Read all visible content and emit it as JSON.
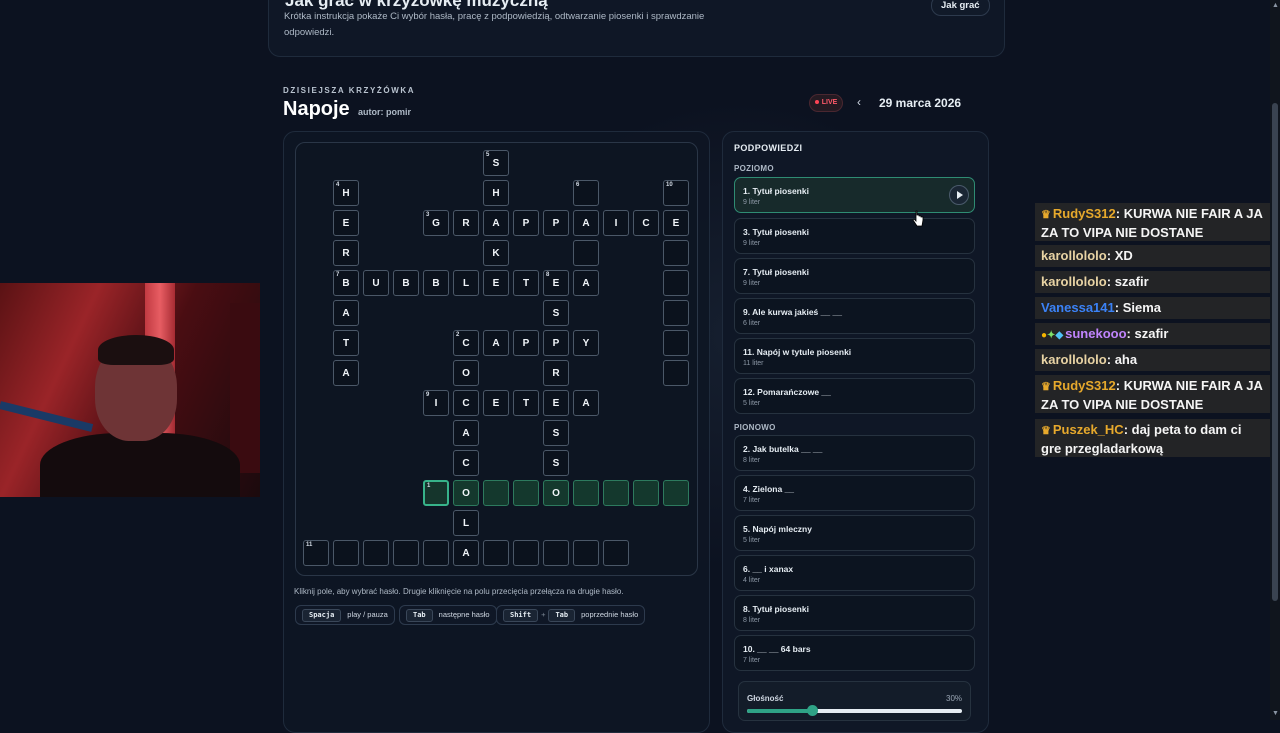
{
  "intro": {
    "title_cut": "Jak grać w krzyżówkę muzyczną",
    "description": "Krótka instrukcja pokaże Ci wybór hasła, pracę z podpowiedzią, odtwarzanie piosenki i sprawdzanie odpowiedzi.",
    "button": "Jak grać"
  },
  "header": {
    "overline": "DZISIEJSZA KRZYŻÓWKA",
    "title": "Napoje",
    "author": "autor: pomir",
    "live": "LIVE",
    "prev_icon": "‹",
    "date": "29 marca 2026"
  },
  "grid": {
    "cells": [
      {
        "c": 6,
        "r": 0,
        "n": "5",
        "l": "S"
      },
      {
        "c": 1,
        "r": 1,
        "n": "4",
        "l": "H"
      },
      {
        "c": 6,
        "r": 1,
        "n": "",
        "l": "H"
      },
      {
        "c": 9,
        "r": 1,
        "n": "6",
        "l": ""
      },
      {
        "c": 12,
        "r": 1,
        "n": "10",
        "l": ""
      },
      {
        "c": 1,
        "r": 2,
        "n": "",
        "l": "E"
      },
      {
        "c": 4,
        "r": 2,
        "n": "3",
        "l": "G"
      },
      {
        "c": 5,
        "r": 2,
        "n": "",
        "l": "R"
      },
      {
        "c": 6,
        "r": 2,
        "n": "",
        "l": "A"
      },
      {
        "c": 7,
        "r": 2,
        "n": "",
        "l": "P"
      },
      {
        "c": 8,
        "r": 2,
        "n": "",
        "l": "P"
      },
      {
        "c": 9,
        "r": 2,
        "n": "",
        "l": "A"
      },
      {
        "c": 10,
        "r": 2,
        "n": "",
        "l": "I"
      },
      {
        "c": 11,
        "r": 2,
        "n": "",
        "l": "C"
      },
      {
        "c": 12,
        "r": 2,
        "n": "",
        "l": "E"
      },
      {
        "c": 1,
        "r": 3,
        "n": "",
        "l": "R"
      },
      {
        "c": 6,
        "r": 3,
        "n": "",
        "l": "K"
      },
      {
        "c": 9,
        "r": 3,
        "n": "",
        "l": ""
      },
      {
        "c": 12,
        "r": 3,
        "n": "",
        "l": ""
      },
      {
        "c": 1,
        "r": 4,
        "n": "7",
        "l": "B"
      },
      {
        "c": 2,
        "r": 4,
        "n": "",
        "l": "U"
      },
      {
        "c": 3,
        "r": 4,
        "n": "",
        "l": "B"
      },
      {
        "c": 4,
        "r": 4,
        "n": "",
        "l": "B"
      },
      {
        "c": 5,
        "r": 4,
        "n": "",
        "l": "L"
      },
      {
        "c": 6,
        "r": 4,
        "n": "",
        "l": "E"
      },
      {
        "c": 7,
        "r": 4,
        "n": "",
        "l": "T"
      },
      {
        "c": 8,
        "r": 4,
        "n": "8",
        "l": "E"
      },
      {
        "c": 9,
        "r": 4,
        "n": "",
        "l": "A"
      },
      {
        "c": 12,
        "r": 4,
        "n": "",
        "l": ""
      },
      {
        "c": 1,
        "r": 5,
        "n": "",
        "l": "A"
      },
      {
        "c": 8,
        "r": 5,
        "n": "",
        "l": "S"
      },
      {
        "c": 12,
        "r": 5,
        "n": "",
        "l": ""
      },
      {
        "c": 1,
        "r": 6,
        "n": "",
        "l": "T"
      },
      {
        "c": 5,
        "r": 6,
        "n": "2",
        "l": "C"
      },
      {
        "c": 6,
        "r": 6,
        "n": "",
        "l": "A"
      },
      {
        "c": 7,
        "r": 6,
        "n": "",
        "l": "P"
      },
      {
        "c": 8,
        "r": 6,
        "n": "",
        "l": "P"
      },
      {
        "c": 9,
        "r": 6,
        "n": "",
        "l": "Y"
      },
      {
        "c": 12,
        "r": 6,
        "n": "",
        "l": ""
      },
      {
        "c": 1,
        "r": 7,
        "n": "",
        "l": "A"
      },
      {
        "c": 5,
        "r": 7,
        "n": "",
        "l": "O"
      },
      {
        "c": 8,
        "r": 7,
        "n": "",
        "l": "R"
      },
      {
        "c": 12,
        "r": 7,
        "n": "",
        "l": ""
      },
      {
        "c": 4,
        "r": 8,
        "n": "9",
        "l": "I"
      },
      {
        "c": 5,
        "r": 8,
        "n": "",
        "l": "C"
      },
      {
        "c": 6,
        "r": 8,
        "n": "",
        "l": "E"
      },
      {
        "c": 7,
        "r": 8,
        "n": "",
        "l": "T"
      },
      {
        "c": 8,
        "r": 8,
        "n": "",
        "l": "E"
      },
      {
        "c": 9,
        "r": 8,
        "n": "",
        "l": "A"
      },
      {
        "c": 5,
        "r": 9,
        "n": "",
        "l": "A"
      },
      {
        "c": 8,
        "r": 9,
        "n": "",
        "l": "S"
      },
      {
        "c": 5,
        "r": 10,
        "n": "",
        "l": "C"
      },
      {
        "c": 8,
        "r": 10,
        "n": "",
        "l": "S"
      },
      {
        "c": 4,
        "r": 11,
        "n": "1",
        "l": "",
        "s": "active"
      },
      {
        "c": 5,
        "r": 11,
        "n": "",
        "l": "O",
        "s": "hl"
      },
      {
        "c": 6,
        "r": 11,
        "n": "",
        "l": "",
        "s": "hl"
      },
      {
        "c": 7,
        "r": 11,
        "n": "",
        "l": "",
        "s": "hl"
      },
      {
        "c": 8,
        "r": 11,
        "n": "",
        "l": "O",
        "s": "hl"
      },
      {
        "c": 9,
        "r": 11,
        "n": "",
        "l": "",
        "s": "hl"
      },
      {
        "c": 10,
        "r": 11,
        "n": "",
        "l": "",
        "s": "hl"
      },
      {
        "c": 11,
        "r": 11,
        "n": "",
        "l": "",
        "s": "hl"
      },
      {
        "c": 12,
        "r": 11,
        "n": "",
        "l": "",
        "s": "hl"
      },
      {
        "c": 5,
        "r": 12,
        "n": "",
        "l": "L"
      },
      {
        "c": 0,
        "r": 13,
        "n": "11",
        "l": ""
      },
      {
        "c": 1,
        "r": 13,
        "n": "",
        "l": ""
      },
      {
        "c": 2,
        "r": 13,
        "n": "",
        "l": ""
      },
      {
        "c": 3,
        "r": 13,
        "n": "",
        "l": ""
      },
      {
        "c": 4,
        "r": 13,
        "n": "",
        "l": ""
      },
      {
        "c": 5,
        "r": 13,
        "n": "",
        "l": "A"
      },
      {
        "c": 6,
        "r": 13,
        "n": "",
        "l": ""
      },
      {
        "c": 7,
        "r": 13,
        "n": "",
        "l": ""
      },
      {
        "c": 8,
        "r": 13,
        "n": "",
        "l": ""
      },
      {
        "c": 9,
        "r": 13,
        "n": "",
        "l": ""
      },
      {
        "c": 10,
        "r": 13,
        "n": "",
        "l": ""
      }
    ]
  },
  "help": {
    "text": "Kliknij pole, aby wybrać hasło. Drugie kliknięcie na polu przecięcia przełącza na drugie hasło.",
    "space_key": "Spacja",
    "space_label": "play / pauza",
    "tab_key": "Tab",
    "tab_label": "następne hasło",
    "shift_key": "Shift",
    "plus": "+",
    "shift_tab_key": "Tab",
    "shift_tab_label": "poprzednie hasło"
  },
  "clues": {
    "title": "PODPOWIEDZI",
    "across_label": "POZIOMO",
    "down_label": "PIONOWO",
    "across": [
      {
        "text": "1. Tytuł piosenki",
        "len": "9 liter"
      },
      {
        "text": "3. Tytuł piosenki",
        "len": "9 liter"
      },
      {
        "text": "7. Tytuł piosenki",
        "len": "9 liter"
      },
      {
        "text": "9. Ale kurwa jakieś __ __",
        "len": "6 liter"
      },
      {
        "text": "11. Napój w tytule piosenki",
        "len": "11 liter"
      },
      {
        "text": "12. Pomarańczowe __",
        "len": "5 liter"
      }
    ],
    "down": [
      {
        "text": "2. Jak butelka __ __",
        "len": "8 liter"
      },
      {
        "text": "4. Zielona __",
        "len": "7 liter"
      },
      {
        "text": "5. Napój mleczny",
        "len": "5 liter"
      },
      {
        "text": "6. __ i xanax",
        "len": "4 liter"
      },
      {
        "text": "8. Tytuł piosenki",
        "len": "8 liter"
      },
      {
        "text": "10. __ __ 64 bars",
        "len": "7 liter"
      }
    ],
    "volume_label": "Głośność",
    "volume_value": "30%",
    "volume_fraction": 0.3
  },
  "chat": [
    {
      "user": "RudyS312",
      "color": "#e7a92c",
      "crown": true,
      "text": "KURWA NIE FAIR A JA ZA TO VIPA NIE DOSTANE"
    },
    {
      "user": "karollololo",
      "color": "#e8d3a4",
      "crown": false,
      "text": "XD"
    },
    {
      "user": "karollololo",
      "color": "#e8d3a4",
      "crown": false,
      "text": "szafir"
    },
    {
      "user": "Vanessa141",
      "color": "#3b82f6",
      "crown": false,
      "text": "Siema"
    },
    {
      "user": "sunekooo",
      "color": "#c084fc",
      "crown": false,
      "badges": true,
      "text": "szafir"
    },
    {
      "user": "karollololo",
      "color": "#e8d3a4",
      "crown": false,
      "text": "aha"
    },
    {
      "user": "RudyS312",
      "color": "#e7a92c",
      "crown": true,
      "text": "KURWA NIE FAIR A JA ZA TO VIPA NIE DOSTANE"
    },
    {
      "user": "Puszek_HC",
      "color": "#e7a92c",
      "crown": true,
      "text": "daj peta to dam ci gre przegladarkową"
    }
  ]
}
